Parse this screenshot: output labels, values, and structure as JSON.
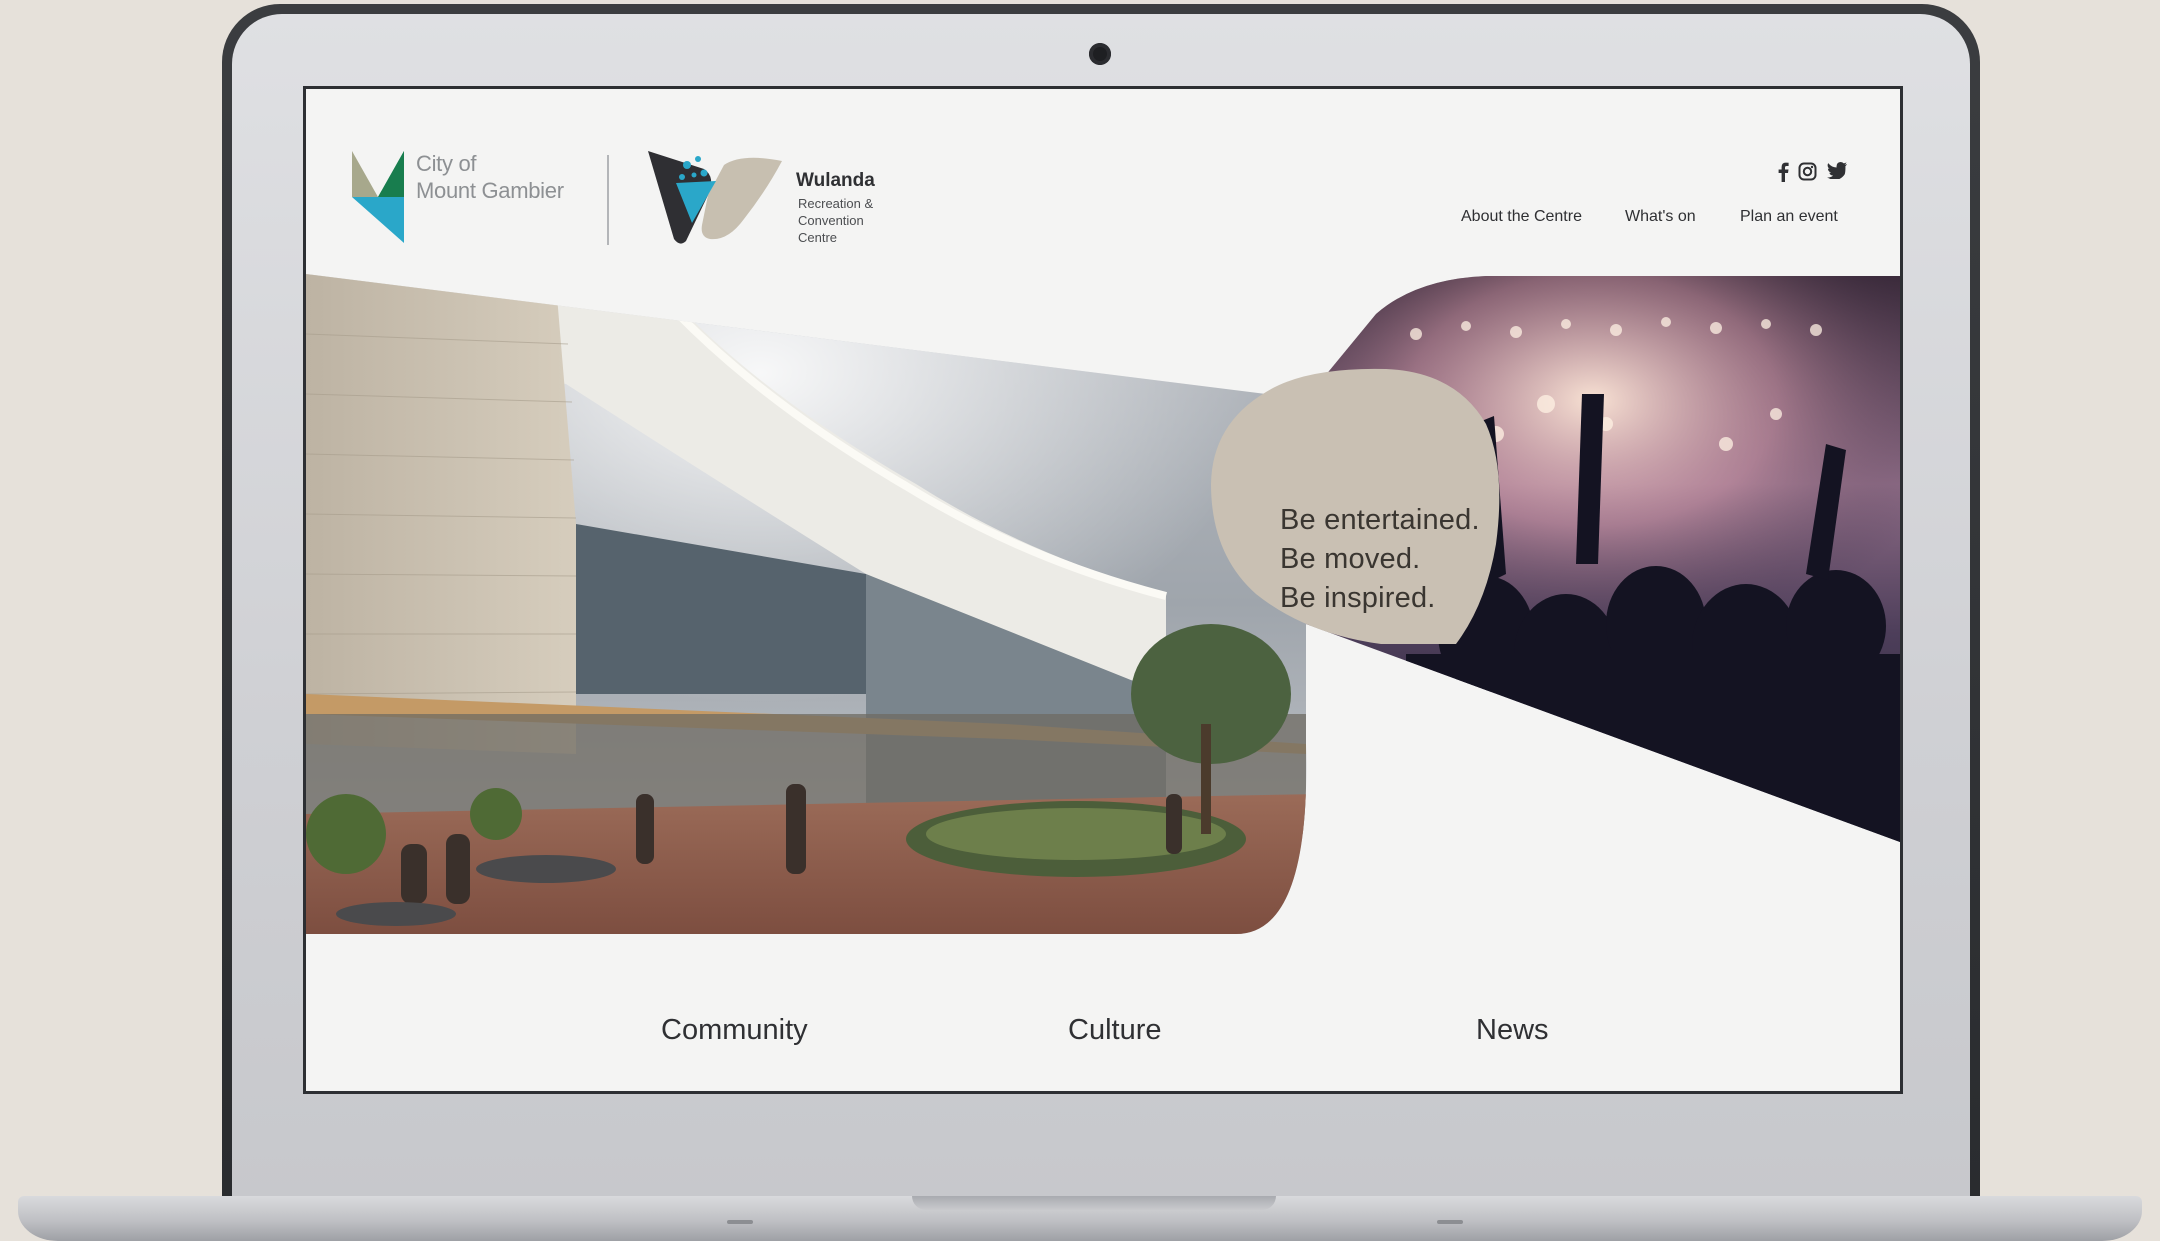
{
  "header": {
    "city_logo": {
      "line1": "City of",
      "line2": "Mount Gambier"
    },
    "wulanda_logo": {
      "title": "Wulanda",
      "subtitle_lines": [
        "Recreation &",
        "Convention",
        "Centre"
      ]
    },
    "social_icons": [
      "facebook-icon",
      "instagram-icon",
      "twitter-icon"
    ],
    "nav": [
      "About the Centre",
      "What's on",
      "Plan an event"
    ]
  },
  "hero": {
    "taglines": [
      "Be entertained.",
      "Be moved.",
      "Be inspired."
    ],
    "colors": {
      "tagline_blob": "#c9c0b3",
      "accent_teal": "#2aa7c9",
      "accent_green": "#1d8f5a"
    }
  },
  "categories": [
    "Community",
    "Culture",
    "News"
  ]
}
